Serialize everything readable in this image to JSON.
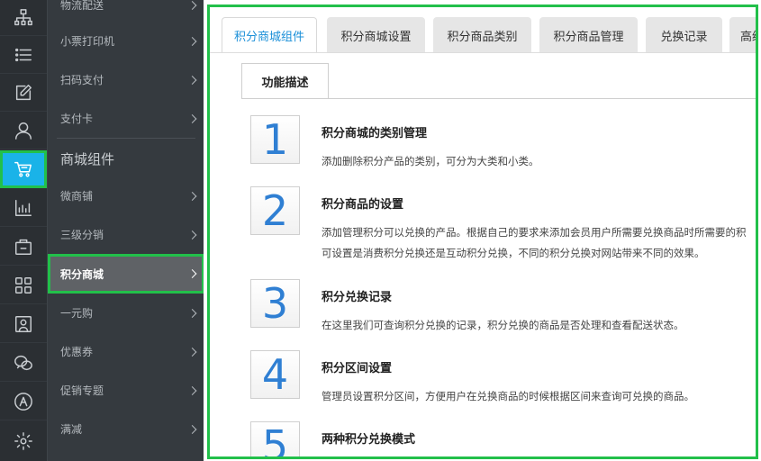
{
  "rail": {
    "items": [
      {
        "icon": "network-icon"
      },
      {
        "icon": "list-icon"
      },
      {
        "icon": "edit-icon"
      },
      {
        "icon": "user-icon"
      },
      {
        "icon": "cart-icon",
        "active": true
      },
      {
        "icon": "chart-icon"
      },
      {
        "icon": "bag-icon"
      },
      {
        "icon": "grid-icon"
      },
      {
        "icon": "picture-icon"
      },
      {
        "icon": "wechat-icon"
      },
      {
        "icon": "appstore-icon"
      },
      {
        "icon": "gear-icon"
      }
    ],
    "active_color": "#1ab3e8"
  },
  "submenu": {
    "top_items": [
      "物流配送",
      "小票打印机",
      "扫码支付",
      "支付卡"
    ],
    "group_title": "商城组件",
    "items": [
      "微商铺",
      "三级分销",
      "积分商城",
      "一元购",
      "优惠券",
      "促销专题",
      "满减"
    ],
    "active_item": "积分商城"
  },
  "tabs": [
    "积分商城组件",
    "积分商城设置",
    "积分商品类别",
    "积分商品管理",
    "兑换记录",
    "高级"
  ],
  "active_tab": "积分商城组件",
  "subtab": "功能描述",
  "features": [
    {
      "num": "1",
      "title": "积分商城的类别管理",
      "desc": [
        "添加删除积分产品的类别，可分为大类和小类。"
      ]
    },
    {
      "num": "2",
      "title": "积分商品的设置",
      "desc": [
        "添加管理积分可以兑换的产品。根据自己的要求来添加会员用户所需要兑换商品时所需要的积",
        "可设置是消费积分兑换还是互动积分兑换，不同的积分兑换对网站带来不同的效果。"
      ]
    },
    {
      "num": "3",
      "title": "积分兑换记录",
      "desc": [
        "在这里我们可查询积分兑换的记录，积分兑换的商品是否处理和查看配送状态。"
      ]
    },
    {
      "num": "4",
      "title": "积分区间设置",
      "desc": [
        "管理员设置积分区间，方便用户在兑换商品的时候根据区间来查询可兑换的商品。"
      ]
    },
    {
      "num": "5",
      "title": "两种积分兑换模式",
      "desc": [
        ""
      ]
    }
  ],
  "colors": {
    "highlight": "#22c04a",
    "number": "#2f7fd3",
    "tab_active_text": "#1a8fd8"
  }
}
